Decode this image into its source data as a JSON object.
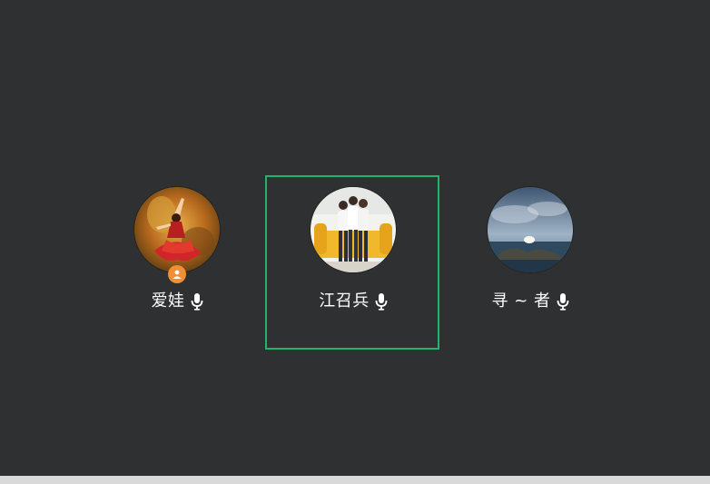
{
  "participants": [
    {
      "name": "爱娃",
      "avatar_icon": "dancer-photo-avatar",
      "is_host": true,
      "mic_icon": "microphone-icon"
    },
    {
      "name": "江召兵",
      "avatar_icon": "family-photo-avatar",
      "is_host": false,
      "speaking": true,
      "mic_icon": "microphone-icon"
    },
    {
      "name": "寻 ~ 者",
      "avatar_icon": "seascape-photo-avatar",
      "is_host": false,
      "mic_icon": "microphone-icon"
    }
  ],
  "colors": {
    "background": "#2e3031",
    "speaking_border": "#23b26d",
    "host_badge": "#f08f33",
    "text": "#ffffff"
  }
}
